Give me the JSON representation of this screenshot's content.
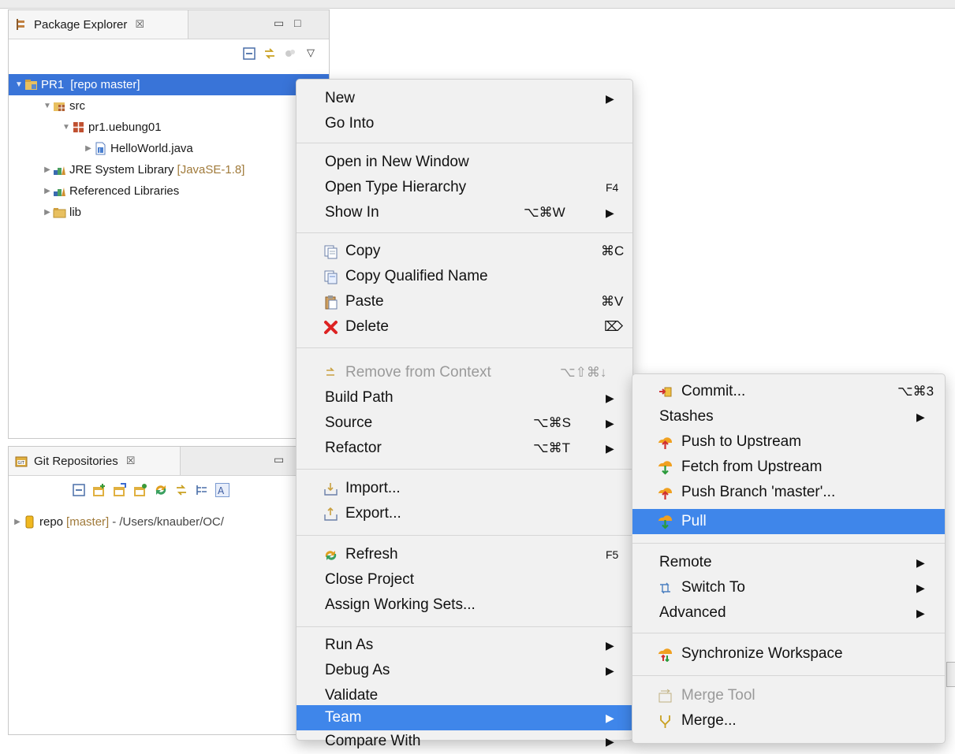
{
  "package_explorer": {
    "title": "Package Explorer",
    "close_glyph": "☒",
    "tree": [
      {
        "label": "PR1",
        "decoration": "[repo master]",
        "selected": true,
        "icon": "project-icon"
      },
      {
        "label": "src",
        "icon": "source-folder-icon"
      },
      {
        "label": "pr1.uebung01",
        "icon": "package-icon"
      },
      {
        "label": "HelloWorld.java",
        "icon": "java-file-icon"
      },
      {
        "label": "JRE System Library",
        "decoration": "[JavaSE-1.8]",
        "icon": "library-icon"
      },
      {
        "label": "Referenced Libraries",
        "icon": "library-icon"
      },
      {
        "label": "lib",
        "icon": "folder-icon"
      }
    ]
  },
  "git_repositories": {
    "title": "Git Repositories",
    "close_glyph": "☒",
    "repo_label": "repo",
    "repo_branch": "[master]",
    "repo_path": " - /Users/knauber/OC/"
  },
  "context_menu": {
    "items": {
      "new": "New",
      "go_into": "Go Into",
      "open_new_window": "Open in New Window",
      "open_type_hierarchy": "Open Type Hierarchy",
      "open_type_hierarchy_sc": "F4",
      "show_in": "Show In",
      "show_in_sc": "⌥⌘W",
      "copy": "Copy",
      "copy_sc": "⌘C",
      "copy_qualified": "Copy Qualified Name",
      "paste": "Paste",
      "paste_sc": "⌘V",
      "delete": "Delete",
      "delete_sc": "⌦",
      "remove_context": "Remove from Context",
      "remove_context_sc": "⌥⇧⌘↓",
      "build_path": "Build Path",
      "source": "Source",
      "source_sc": "⌥⌘S",
      "refactor": "Refactor",
      "refactor_sc": "⌥⌘T",
      "import": "Import...",
      "export": "Export...",
      "refresh": "Refresh",
      "refresh_sc": "F5",
      "close_project": "Close Project",
      "assign_working_sets": "Assign Working Sets...",
      "run_as": "Run As",
      "debug_as": "Debug As",
      "validate": "Validate",
      "team": "Team",
      "compare_with": "Compare With"
    }
  },
  "team_menu": {
    "items": {
      "commit": "Commit...",
      "commit_sc": "⌥⌘3",
      "stashes": "Stashes",
      "push_upstream": "Push to Upstream",
      "fetch_upstream": "Fetch from Upstream",
      "push_branch": "Push Branch 'master'...",
      "pull": "Pull",
      "remote": "Remote",
      "switch_to": "Switch To",
      "advanced": "Advanced",
      "synchronize": "Synchronize Workspace",
      "merge_tool": "Merge Tool",
      "merge": "Merge..."
    }
  },
  "glyphs": {
    "submenu_arrow": "▶",
    "tree_expanded": "▼",
    "tree_collapsed": "▶"
  },
  "colors": {
    "selection": "#3f86ea",
    "tree_selection": "#3974d8",
    "decoration": "#a07a3a"
  }
}
